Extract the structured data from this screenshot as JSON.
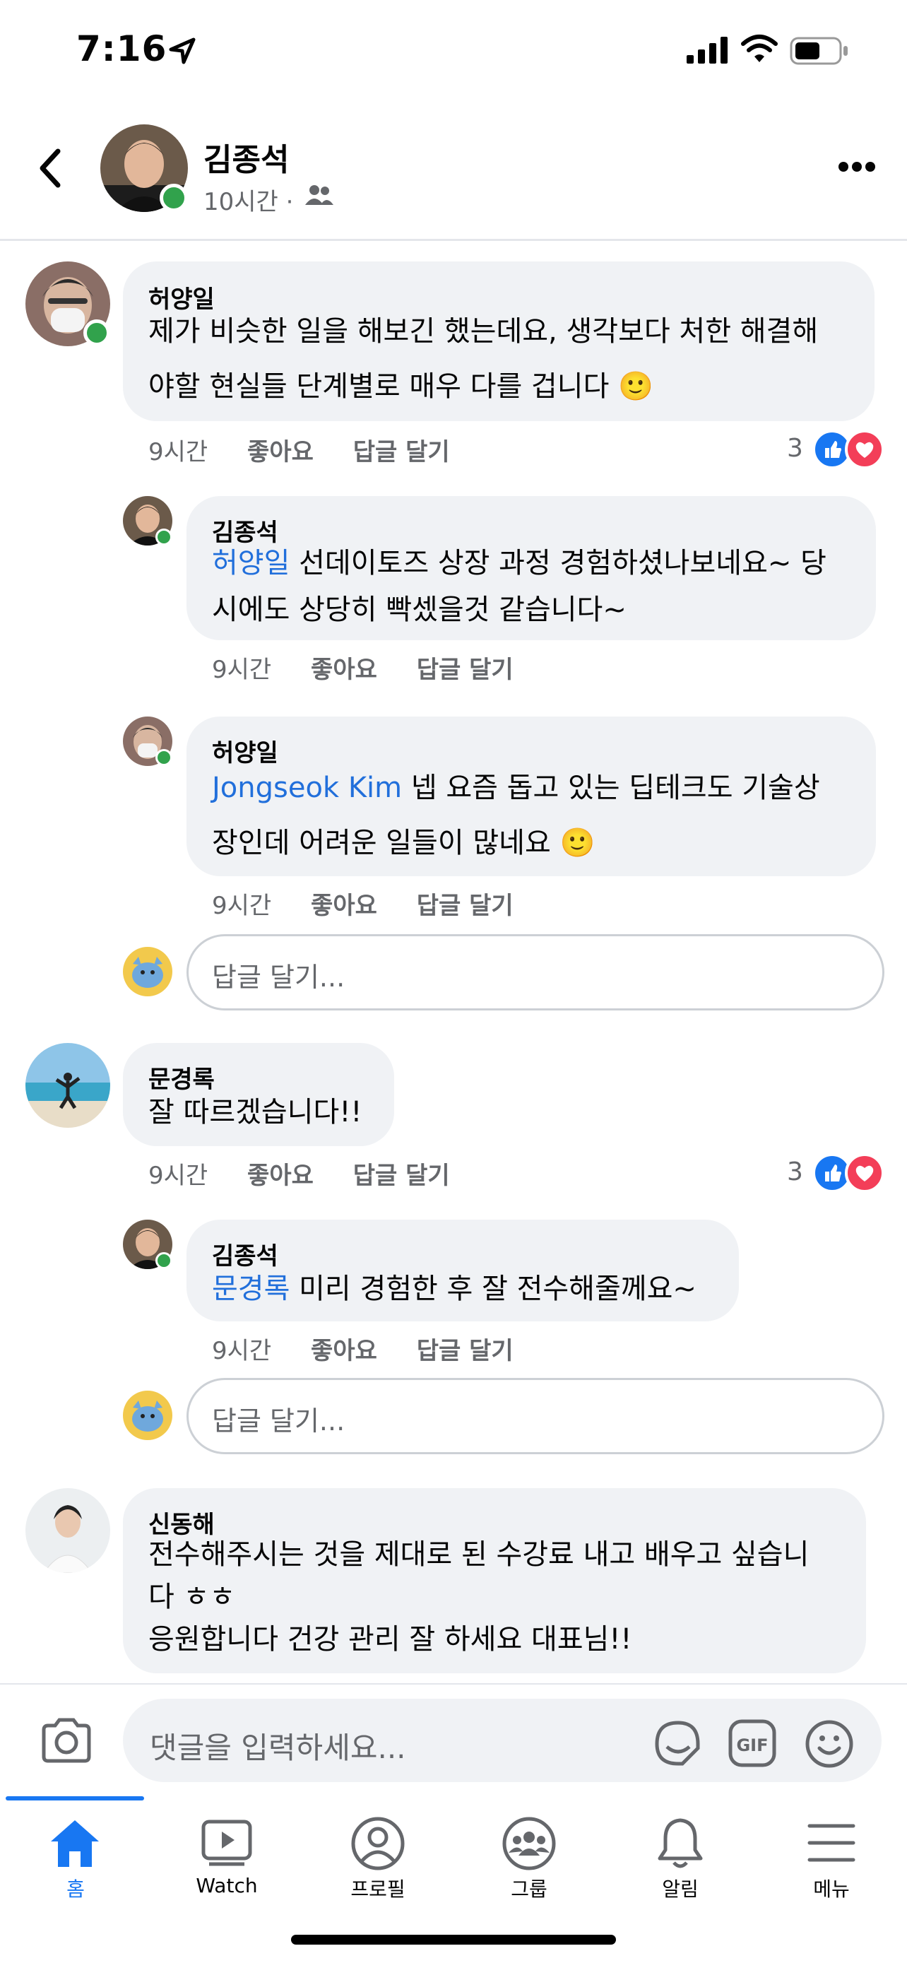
{
  "status_bar": {
    "time": "7:16"
  },
  "header": {
    "name": "김종석",
    "meta": "10시간 ·",
    "icons": [
      "back-chevron-icon",
      "audience-friends-icon",
      "more-icon"
    ]
  },
  "comments": [
    {
      "name": "허양일",
      "lines": [
        "제가 비슷한 일을 해보긴 했는데요, 생각보다 처한 해결해",
        "야할 현실들 단계별로 매우 다를 겁니다 🙂"
      ],
      "time": "9시간",
      "like": "좋아요",
      "reply": "답글 달기",
      "reactions": "3",
      "replies": [
        {
          "name": "김종석",
          "mention": "허양일",
          "lines": [
            "선데이토즈 상장 과정 경험하셨나보네요~ 당",
            "시에도 상당히 빡셌을것 같습니다~"
          ],
          "time": "9시간",
          "like": "좋아요",
          "reply": "답글 달기"
        },
        {
          "name": "허양일",
          "mention": "Jongseok Kim",
          "lines": [
            "넵 요즘 돕고 있는 딥테크도 기술상",
            "장인데 어려운 일들이 많네요 🙂"
          ],
          "time": "9시간",
          "like": "좋아요",
          "reply": "답글 달기"
        }
      ],
      "reply_placeholder": "답글 달기..."
    },
    {
      "name": "문경록",
      "lines": [
        "잘 따르겠습니다!!"
      ],
      "time": "9시간",
      "like": "좋아요",
      "reply": "답글 달기",
      "reactions": "3",
      "replies": [
        {
          "name": "김종석",
          "mention": "문경록",
          "lines": [
            "미리 경험한 후 잘 전수해줄께요~"
          ],
          "time": "9시간",
          "like": "좋아요",
          "reply": "답글 달기"
        }
      ],
      "reply_placeholder": "답글 달기..."
    },
    {
      "name": "신동해",
      "lines": [
        "전수해주시는 것을 제대로 된 수강료 내고 배우고 싶습니",
        "다 ㅎㅎ",
        "응원합니다 건강 관리 잘 하세요 대표님!!"
      ]
    }
  ],
  "comment_input": {
    "placeholder": "댓글을 입력하세요..."
  },
  "tabs": [
    {
      "label": "홈",
      "icon": "home-icon",
      "active": true
    },
    {
      "label": "Watch",
      "icon": "watch-icon"
    },
    {
      "label": "프로필",
      "icon": "profile-icon"
    },
    {
      "label": "그룹",
      "icon": "groups-icon"
    },
    {
      "label": "알림",
      "icon": "bell-icon"
    },
    {
      "label": "메뉴",
      "icon": "menu-icon"
    }
  ],
  "colors": {
    "accent": "#1877f2",
    "bubble": "#f0f2f5",
    "online": "#31a24c",
    "mention": "#216fdb"
  }
}
